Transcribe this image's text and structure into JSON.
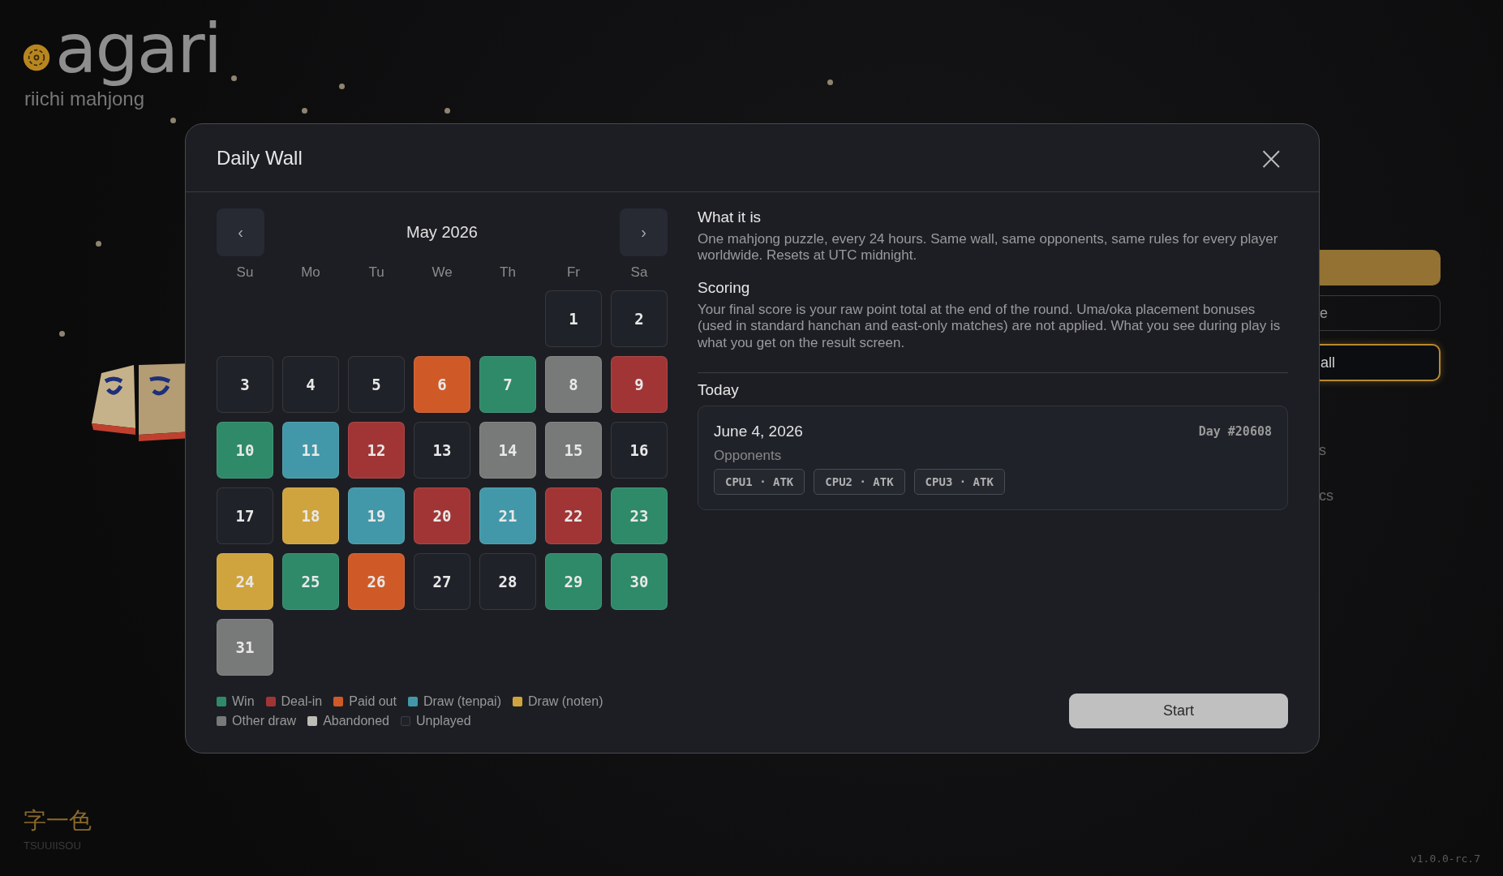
{
  "logo": {
    "wordmark": "agari",
    "tagline": "riichi mahjong"
  },
  "menu": [
    {
      "kind": "primary"
    },
    {
      "kind": "outline",
      "label": "e"
    },
    {
      "kind": "highlight",
      "label": "all"
    },
    {
      "kind": "text",
      "label": "s"
    },
    {
      "kind": "text",
      "label": "cs"
    }
  ],
  "yaku": {
    "kanji": "字一色",
    "romaji": "TSUUIISOU"
  },
  "version": "v1.0.0-rc.7",
  "dialog": {
    "title": "Daily Wall",
    "close": "×",
    "calendar": {
      "month": "May 2026",
      "prev": "‹",
      "next": "›",
      "weekdays": [
        "Su",
        "Mo",
        "Tu",
        "We",
        "Th",
        "Fr",
        "Sa"
      ],
      "weeks": [
        [
          {
            "day": "1",
            "color": "#202229"
          },
          {
            "day": "2",
            "color": "#202229"
          }
        ],
        [
          {
            "day": "3",
            "color": "#202229"
          },
          {
            "day": "4",
            "color": "#202229"
          },
          {
            "day": "5",
            "color": "#202229"
          },
          {
            "day": "6",
            "color": "#cf5a28"
          },
          {
            "day": "7",
            "color": "#2e8a69"
          },
          {
            "day": "8",
            "color": "#777a78"
          },
          {
            "day": "9",
            "color": "#a13535"
          }
        ],
        [
          {
            "day": "10",
            "color": "#2e8a69"
          },
          {
            "day": "11",
            "color": "#4298a8"
          },
          {
            "day": "12",
            "color": "#a13535"
          },
          {
            "day": "13",
            "color": "#202229"
          },
          {
            "day": "14",
            "color": "#777a78"
          },
          {
            "day": "15",
            "color": "#777a78"
          },
          {
            "day": "16",
            "color": "#202229"
          }
        ],
        [
          {
            "day": "17",
            "color": "#202229"
          },
          {
            "day": "18",
            "color": "#cfa43e"
          },
          {
            "day": "19",
            "color": "#4298a8"
          },
          {
            "day": "20",
            "color": "#a13535"
          },
          {
            "day": "21",
            "color": "#4298a8"
          },
          {
            "day": "22",
            "color": "#a13535"
          },
          {
            "day": "23",
            "color": "#2e8a69"
          }
        ],
        [
          {
            "day": "24",
            "color": "#cfa43e"
          },
          {
            "day": "25",
            "color": "#2e8a69"
          },
          {
            "day": "26",
            "color": "#cf5a28"
          },
          {
            "day": "27",
            "color": "#202229"
          },
          {
            "day": "28",
            "color": "#202229"
          },
          {
            "day": "29",
            "color": "#2e8a69"
          },
          {
            "day": "30",
            "color": "#2e8a69"
          }
        ],
        [
          {
            "day": "31",
            "color": "#777a78"
          }
        ]
      ]
    },
    "legend": [
      {
        "kind": "win",
        "label": "Win",
        "color": "#2e8a69"
      },
      {
        "kind": "dealin",
        "label": "Deal-in",
        "color": "#a13535"
      },
      {
        "kind": "paid",
        "label": "Paid out",
        "color": "#cf5a28"
      },
      {
        "kind": "tenpai",
        "label": "Draw (tenpai)",
        "color": "#4298a8"
      },
      {
        "kind": "noten",
        "label": "Draw (noten)",
        "color": "#cfa43e"
      },
      {
        "kind": "other",
        "label": "Other draw",
        "color": "#777a78"
      },
      {
        "kind": "abandoned",
        "label": "Abandoned",
        "color": "#bdbdb5"
      },
      {
        "kind": "unplayed",
        "label": "Unplayed",
        "color": "#202229"
      }
    ],
    "sections": [
      {
        "heading": "What it is",
        "text": "One mahjong puzzle, every 24 hours. Same wall, same opponents, same rules for every player worldwide. Resets at UTC midnight."
      },
      {
        "heading": "Scoring",
        "text": "Your final score is your raw point total at the end of the round. Uma/oka placement bonuses (used in standard hanchan and east-only matches) are not applied. What you see during play is what you get on the result screen."
      }
    ],
    "today": {
      "heading": "Today",
      "date": "June 4, 2026",
      "day_number": "Day #20608",
      "opponents_label": "Opponents",
      "opponents": [
        "CPU1 · ATK",
        "CPU2 · ATK",
        "CPU3 · ATK"
      ]
    },
    "start": "Start"
  }
}
